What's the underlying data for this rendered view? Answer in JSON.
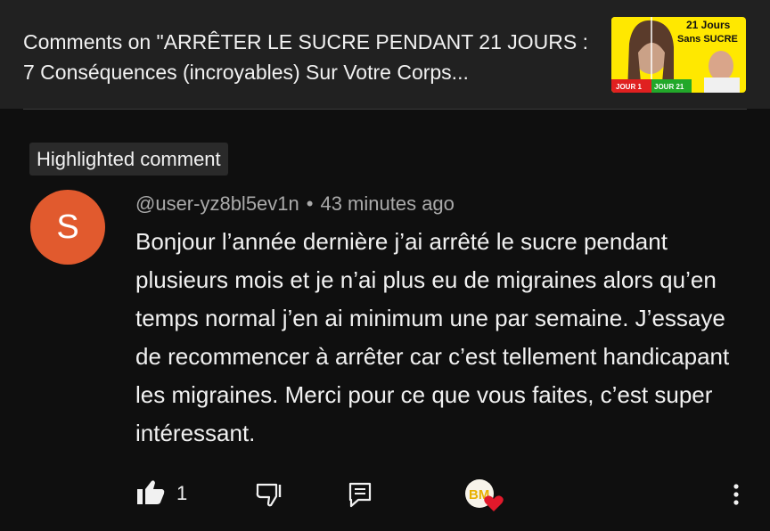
{
  "header": {
    "title": "Comments on \"ARRÊTER LE SUCRE PENDANT 21 JOURS : 7 Conséquences (incroyables) Sur Votre Corps...",
    "thumbnail": {
      "badge_line1": "21 Jours",
      "badge_line2": "Sans SUCRE",
      "label_left": "JOUR 1",
      "label_right": "JOUR 21",
      "colors": {
        "badge_bg": "#ffe800",
        "left_label_bg": "#e02020",
        "right_label_bg": "#22a82a"
      }
    }
  },
  "highlight_label": "Highlighted comment",
  "comment": {
    "avatar_letter": "S",
    "avatar_color": "#e15a2e",
    "author": "@user-yz8bl5ev1n",
    "separator": "•",
    "time": "43 minutes ago",
    "text": "Bonjour l’année dernière j’ai arrêté le sucre pendant plusieurs mois et je n’ai plus eu de migraines alors qu’en temps normal j’en ai minimum une par semaine. J’essaye de recommencer à arrêter car c’est tellement handicapant les migraines. Merci pour ce que vous faites, c’est super intéressant.",
    "like_count": "1",
    "creator_badge_text": "BM"
  },
  "icons": {
    "like": "thumbs-up-icon",
    "dislike": "thumbs-down-icon",
    "reply": "reply-icon",
    "creator_heart": "creator-heart-icon",
    "more": "more-vertical-icon"
  }
}
